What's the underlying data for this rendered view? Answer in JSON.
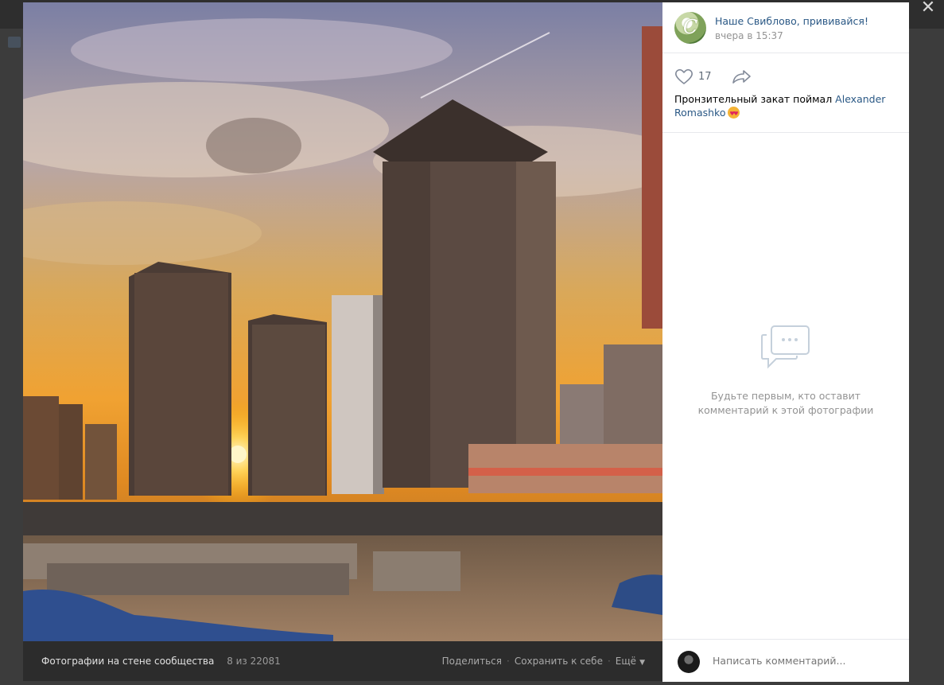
{
  "viewer": {
    "close_icon": "close-icon",
    "photo_footer": {
      "album_label": "Фотографии на стене сообщества",
      "album_counter": "8 из 22081",
      "actions": [
        "Поделиться",
        "Сохранить к себе",
        "Ещё"
      ]
    }
  },
  "post": {
    "group_name": "Наше Свиблово, прививайся!",
    "time": "вчера в 15:37",
    "likes": "17",
    "caption_text": "Пронзительный закат поймал ",
    "caption_author": "Alexander Romashko",
    "caption_emoji": "smiling-face-with-heart-eyes"
  },
  "comments": {
    "empty_text_line1": "Будьте первым, кто оставит",
    "empty_text_line2": "комментарий к этой фотографии",
    "input_placeholder": "Написать комментарий..."
  },
  "colors": {
    "link": "#2a5885",
    "muted": "#939393",
    "footer_bg": "#2c2c2c"
  }
}
